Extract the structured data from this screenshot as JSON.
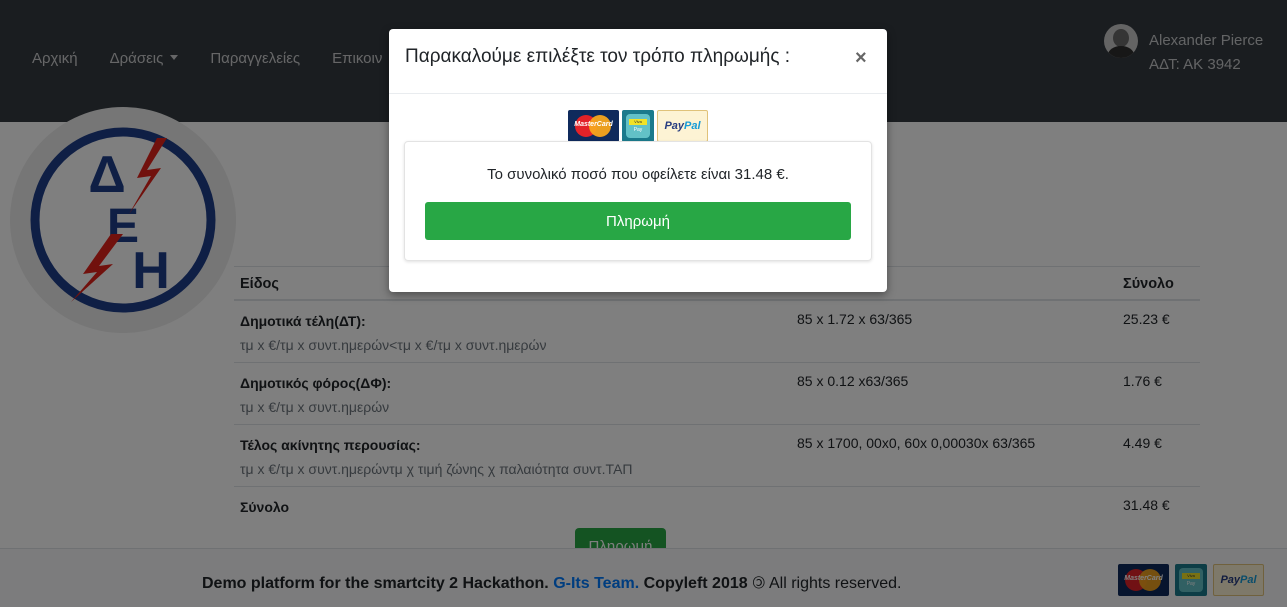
{
  "navbar": {
    "items": [
      {
        "label": "Αρχική"
      },
      {
        "label": "Δράσεις"
      },
      {
        "label": "Παραγγελείες"
      },
      {
        "label": "Επικοιν"
      }
    ],
    "user": {
      "name": "Alexander Pierce",
      "id_line": "ΑΔΤ: ΑΚ 3942"
    }
  },
  "logo": {
    "letters": [
      "Δ",
      "Ε",
      "Η"
    ],
    "color": "#1f3f8a",
    "accent": "#e2231a"
  },
  "bill": {
    "headers": [
      "Είδος",
      "",
      "Σύνολο"
    ],
    "rows": [
      {
        "title": "Δημοτικά τέλη(ΔΤ):",
        "desc": "τμ x €/τμ x συντ.ημερών<τμ x €/τμ x συντ.ημερών",
        "calc": "85 x 1.72 x 63/365",
        "total": "25.23 €"
      },
      {
        "title": "Δημοτικός φόρος(ΔΦ):",
        "desc": "τμ x €/τμ x συντ.ημερών",
        "calc": "85 x 0.12 x63/365",
        "total": "1.76 €"
      },
      {
        "title": "Τέλος ακίνητης περουσίας:",
        "desc": "τμ x €/τμ x συντ.ημερώντμ χ τιμή ζώνης χ παλαιότητα συντ.ΤΑΠ",
        "calc": "85 x 1700, 00x0, 60x 0,00030x 63/365",
        "total": "4.49 €"
      }
    ],
    "sum_label": "Σύνολο",
    "sum_value": "31.48 €"
  },
  "page_pay_button": "Πληρωμή",
  "footer": {
    "text_bold": "Demo platform for the smartcity 2 Hackathon.",
    "team": "G-Its Team.",
    "copyleft": "Copyleft 2018",
    "copyleft_symbol": "🄯",
    "rights": "All rights reserved."
  },
  "modal": {
    "title": "Παρακαλούμε επιλέξτε τον τρόπο πληρωμής :",
    "close": "×",
    "amount_text": "Το συνολικό ποσό που οφείλετε είναι 31.48 €.",
    "pay_button": "Πληρωμή"
  },
  "payment_methods": {
    "mastercard": "MasterCard",
    "vivapay_top": "Viva",
    "vivapay_bottom": "Pay",
    "paypal_a": "Pay",
    "paypal_b": "Pal"
  },
  "colors": {
    "navbar": "#343a40",
    "success": "#28a745",
    "link": "#007bff"
  }
}
